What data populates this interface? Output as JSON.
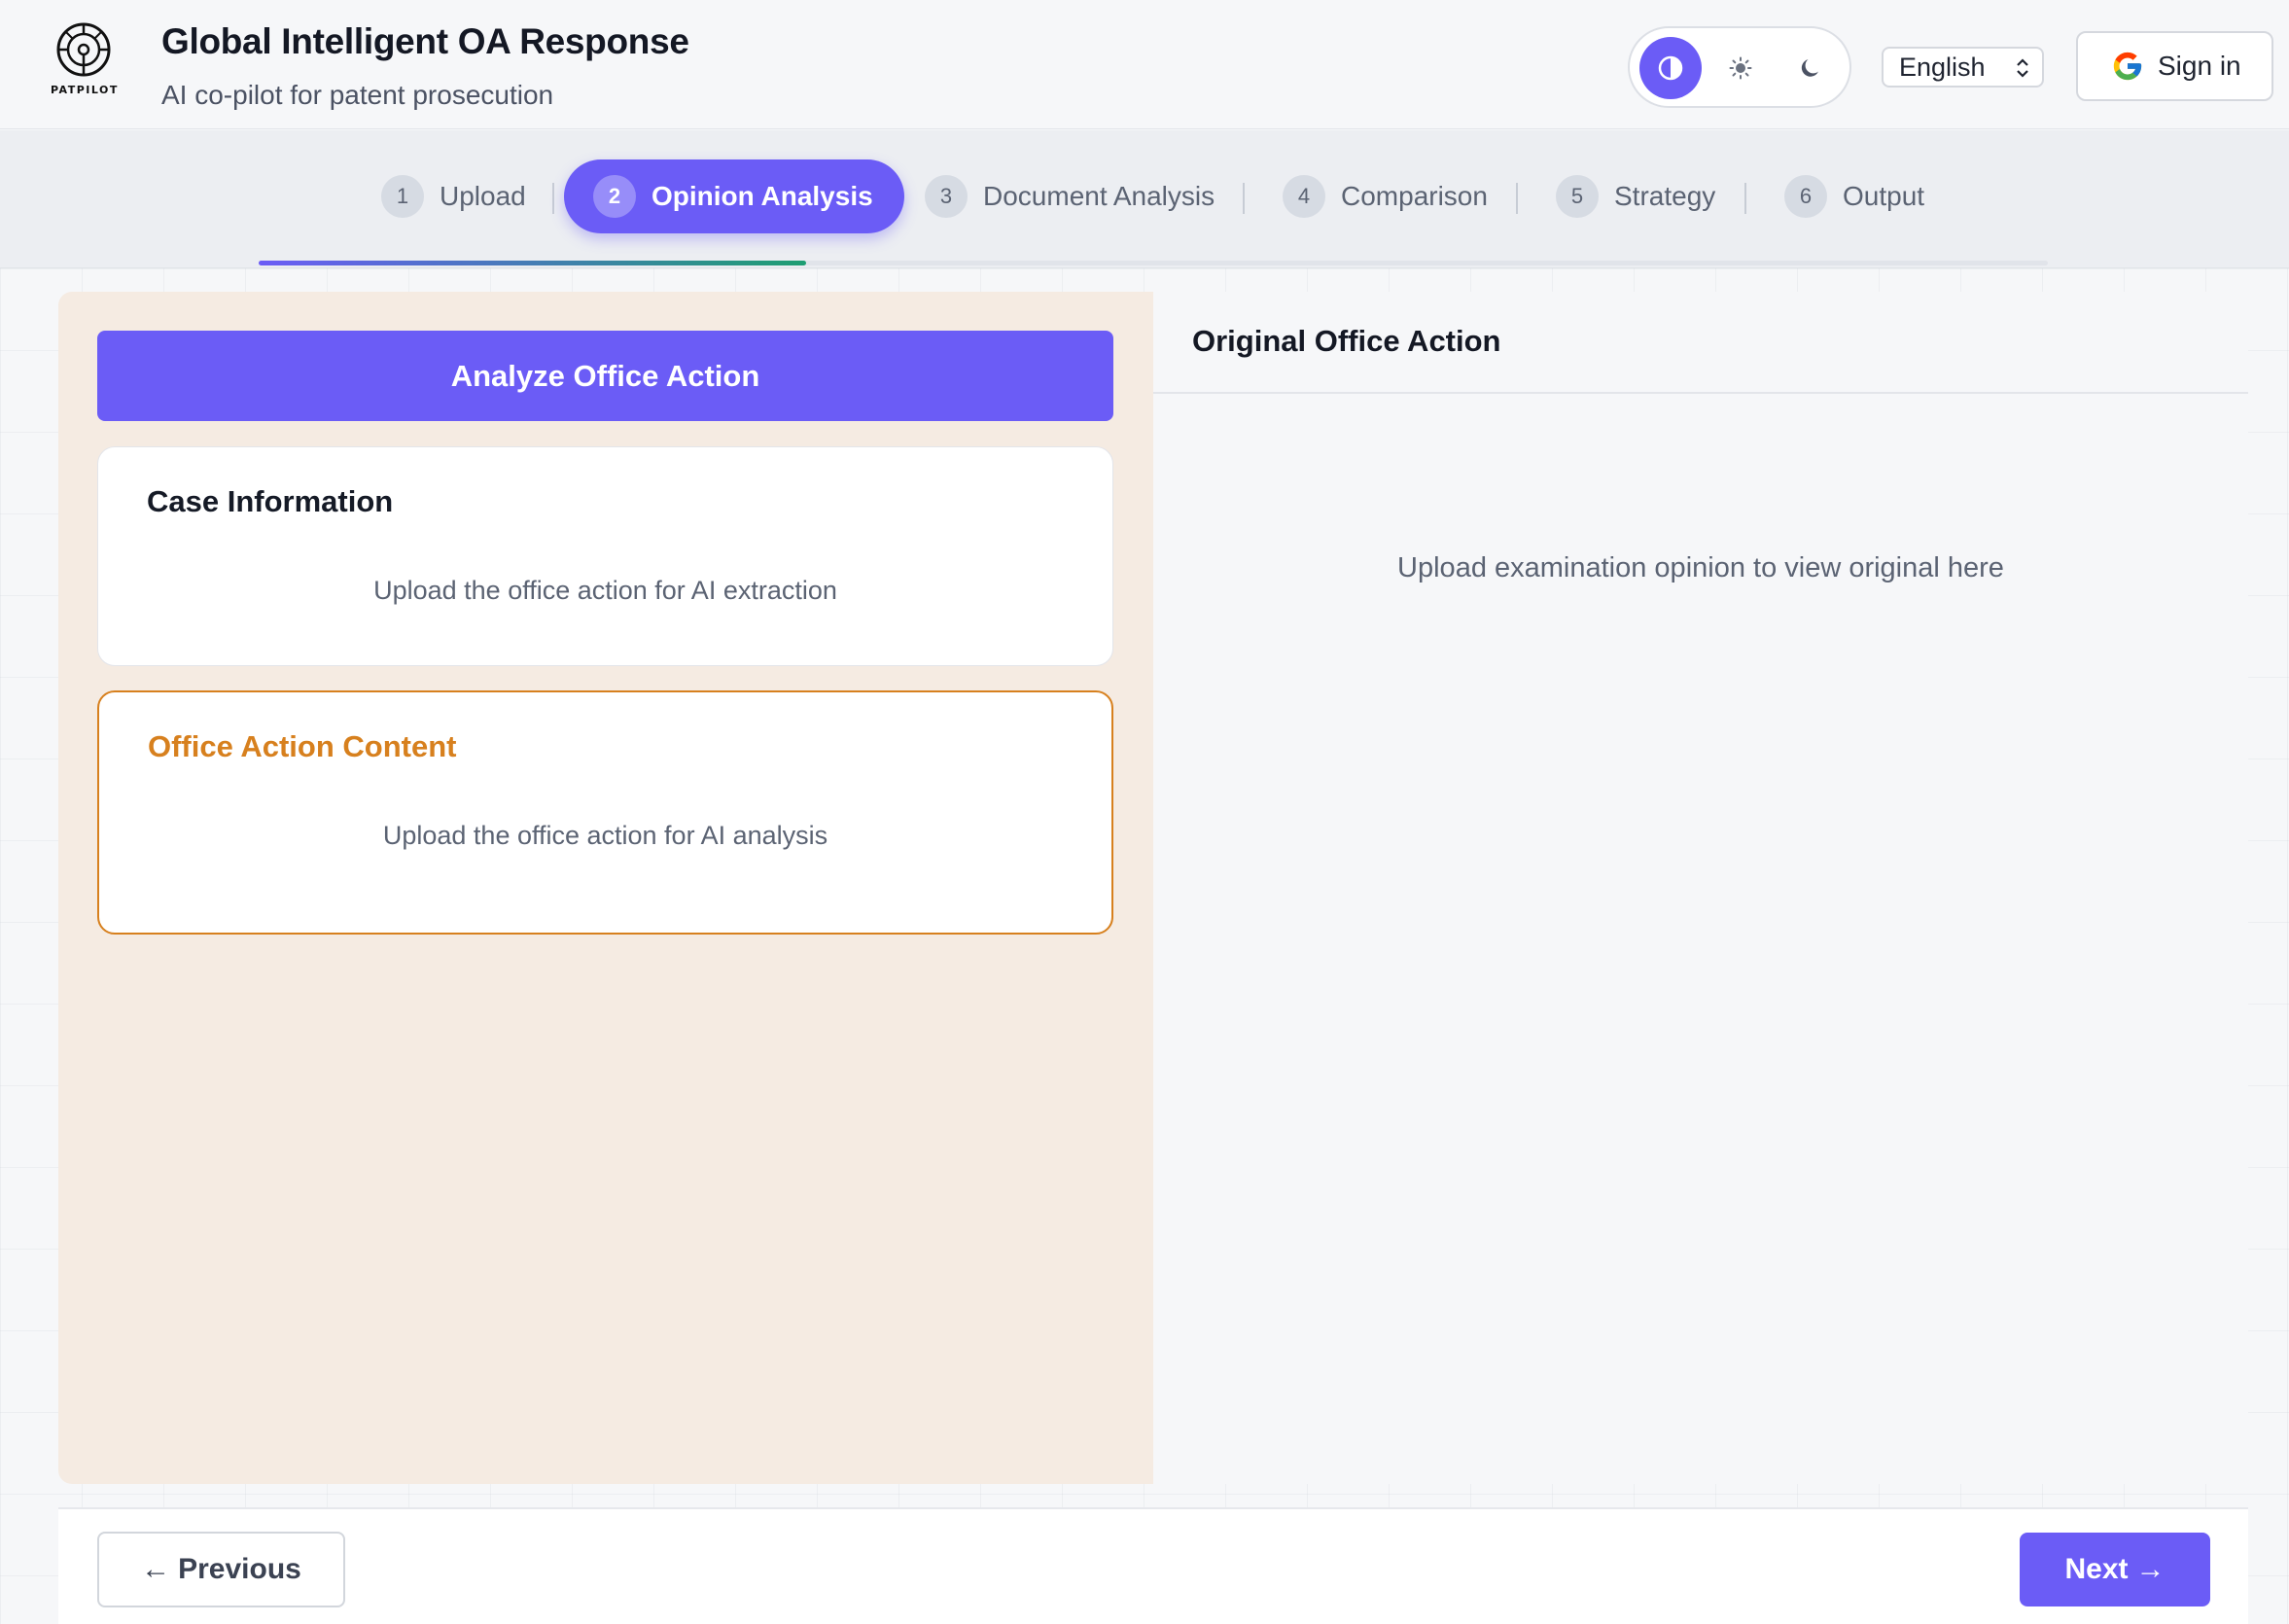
{
  "header": {
    "logo_text": "PATPILOT",
    "title": "Global Intelligent OA Response",
    "subtitle": "AI co-pilot for patent prosecution",
    "theme": {
      "options": [
        "system",
        "light",
        "dark"
      ],
      "selected": "system"
    },
    "language": "English",
    "signin_label": "Sign in"
  },
  "stepper": {
    "steps": [
      {
        "num": "1",
        "label": "Upload"
      },
      {
        "num": "2",
        "label": "Opinion Analysis"
      },
      {
        "num": "3",
        "label": "Document Analysis"
      },
      {
        "num": "4",
        "label": "Comparison"
      },
      {
        "num": "5",
        "label": "Strategy"
      },
      {
        "num": "6",
        "label": "Output"
      }
    ],
    "active_index": 1,
    "progress_fraction": 0.306
  },
  "left": {
    "analyze_label": "Analyze Office Action",
    "case_info": {
      "title": "Case Information",
      "message": "Upload the office action for AI extraction"
    },
    "oa_content": {
      "title": "Office Action Content",
      "message": "Upload the office action for AI analysis"
    }
  },
  "right": {
    "title": "Original Office Action",
    "message": "Upload examination opinion to view original here"
  },
  "footer": {
    "previous_label": "Previous",
    "next_label": "Next"
  },
  "colors": {
    "accent": "#6b5cf6",
    "warning": "#d7801e",
    "panel_bg": "#f5ebe2"
  }
}
